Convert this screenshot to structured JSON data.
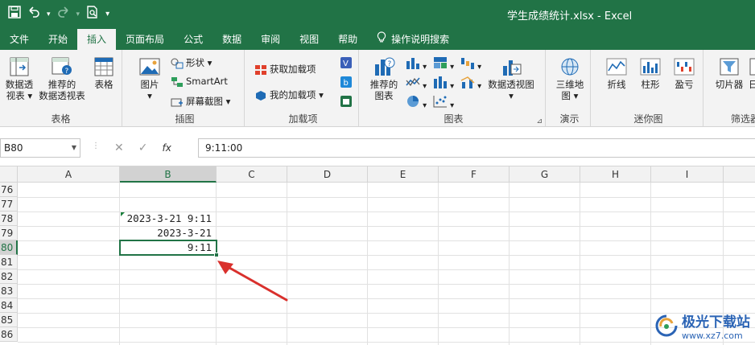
{
  "window": {
    "title": "学生成绩统计.xlsx  -  Excel"
  },
  "quick_access": {
    "icons": [
      "save-icon",
      "undo-icon",
      "redo-icon",
      "print-preview-icon",
      "customize-qat-icon"
    ]
  },
  "tabs": [
    "文件",
    "开始",
    "插入",
    "页面布局",
    "公式",
    "数据",
    "审阅",
    "视图",
    "帮助"
  ],
  "active_tab": "插入",
  "tell_me": "操作说明搜索",
  "ribbon": {
    "tables": {
      "label": "表格",
      "pivot_line1": "数据透",
      "pivot_line2": "视表",
      "recommended_line1": "推荐的",
      "recommended_line2": "数据透视表",
      "table": "表格"
    },
    "illustrations": {
      "label": "插图",
      "pictures": "图片",
      "shapes": "形状",
      "smartart": "SmartArt",
      "screenshot": "屏幕截图"
    },
    "addins": {
      "label": "加载项",
      "get": "获取加载项",
      "my": "我的加载项"
    },
    "charts": {
      "label": "图表",
      "recommended_line1": "推荐的",
      "recommended_line2": "图表",
      "pivotchart": "数据透视图"
    },
    "tours": {
      "label": "演示",
      "map_line1": "三维地",
      "map_line2": "图"
    },
    "sparklines": {
      "label": "迷你图",
      "line": "折线",
      "column": "柱形",
      "winloss": "盈亏"
    },
    "filters": {
      "label": "筛选器",
      "slicer": "切片器",
      "timeline_partial": "日"
    }
  },
  "formula_bar": {
    "name_box": "B80",
    "fx": "fx",
    "content": "9:11:00"
  },
  "columns": [
    "A",
    "B",
    "C",
    "D",
    "E",
    "F",
    "G",
    "H",
    "I"
  ],
  "selected_column": "B",
  "rows": [
    "76",
    "77",
    "78",
    "79",
    "80",
    "81",
    "82",
    "83",
    "84",
    "85",
    "86"
  ],
  "selected_row": "80",
  "cells": {
    "B78": "2023-3-21  9:11",
    "B79": "2023-3-21",
    "B80": "9:11"
  },
  "watermark": {
    "name": "极光下载站",
    "url": "www.xz7.com"
  },
  "colors": {
    "excel_green": "#217346",
    "arrow_red": "#d9302c"
  }
}
